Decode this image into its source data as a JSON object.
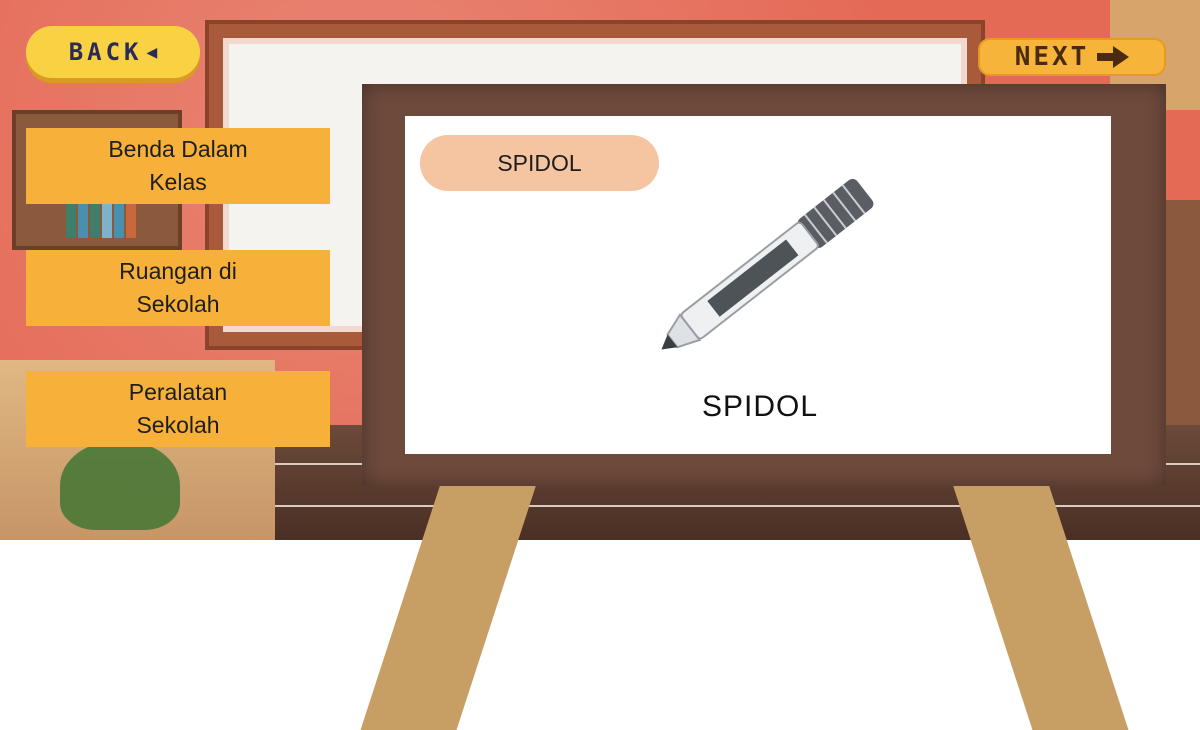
{
  "nav": {
    "back_label": "BACK",
    "next_label": "NEXT"
  },
  "menu": {
    "items": [
      {
        "label": "Benda Dalam\nKelas"
      },
      {
        "label": "Ruangan di\nSekolah"
      },
      {
        "label": "Peralatan\nSekolah"
      }
    ]
  },
  "card": {
    "tag_label": "SPIDOL",
    "image_icon": "marker-pen-icon",
    "caption": "SPIDOL"
  },
  "colors": {
    "wall": "#e46a56",
    "menu_button": "#f7b03a",
    "back_button": "#f9d244",
    "next_button": "#f7b43a",
    "easel_frame": "#6e4a3c",
    "easel_legs": "#c79e63",
    "tag": "#f5c4a0"
  }
}
